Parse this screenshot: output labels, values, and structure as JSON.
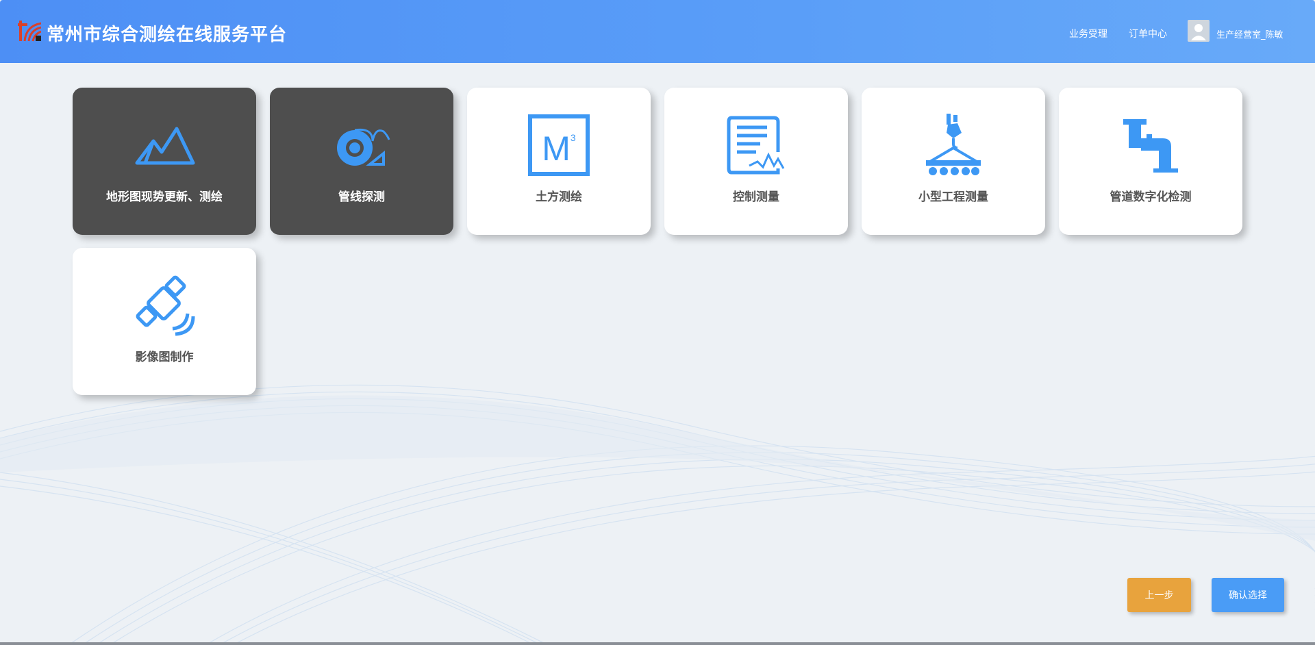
{
  "header": {
    "title": "常州市综合测绘在线服务平台",
    "nav": [
      {
        "label": "业务受理"
      },
      {
        "label": "订单中心"
      }
    ],
    "user": {
      "name": "生产经营室_陈敏"
    },
    "logo_icon": "logo-icon",
    "colors": {
      "header_start": "#4d8ff5",
      "header_end": "#68aaf9",
      "logo_red": "#d9412b"
    }
  },
  "services": [
    {
      "label": "地形图现势更新、测绘",
      "icon": "mountain-icon",
      "selected": true
    },
    {
      "label": "管线探测",
      "icon": "pipe-detector-icon",
      "selected": true
    },
    {
      "label": "土方测绘",
      "icon": "cubic-meter-icon",
      "icon_text": "M",
      "icon_sup": "3",
      "selected": false
    },
    {
      "label": "控制测量",
      "icon": "document-signal-icon",
      "selected": false
    },
    {
      "label": "小型工程测量",
      "icon": "crane-hook-icon",
      "selected": false
    },
    {
      "label": "管道数字化检测",
      "icon": "pipe-icon",
      "selected": false
    },
    {
      "label": "影像图制作",
      "icon": "satellite-icon",
      "selected": false
    }
  ],
  "actions": {
    "prev_label": "上一步",
    "confirm_label": "确认选择"
  },
  "colors": {
    "accent": "#4a9cf6",
    "icon_blue": "#3d98f4",
    "selected_card": "#4e4e4e",
    "prev_button": "#e8a33d",
    "background": "#edf1f5"
  }
}
